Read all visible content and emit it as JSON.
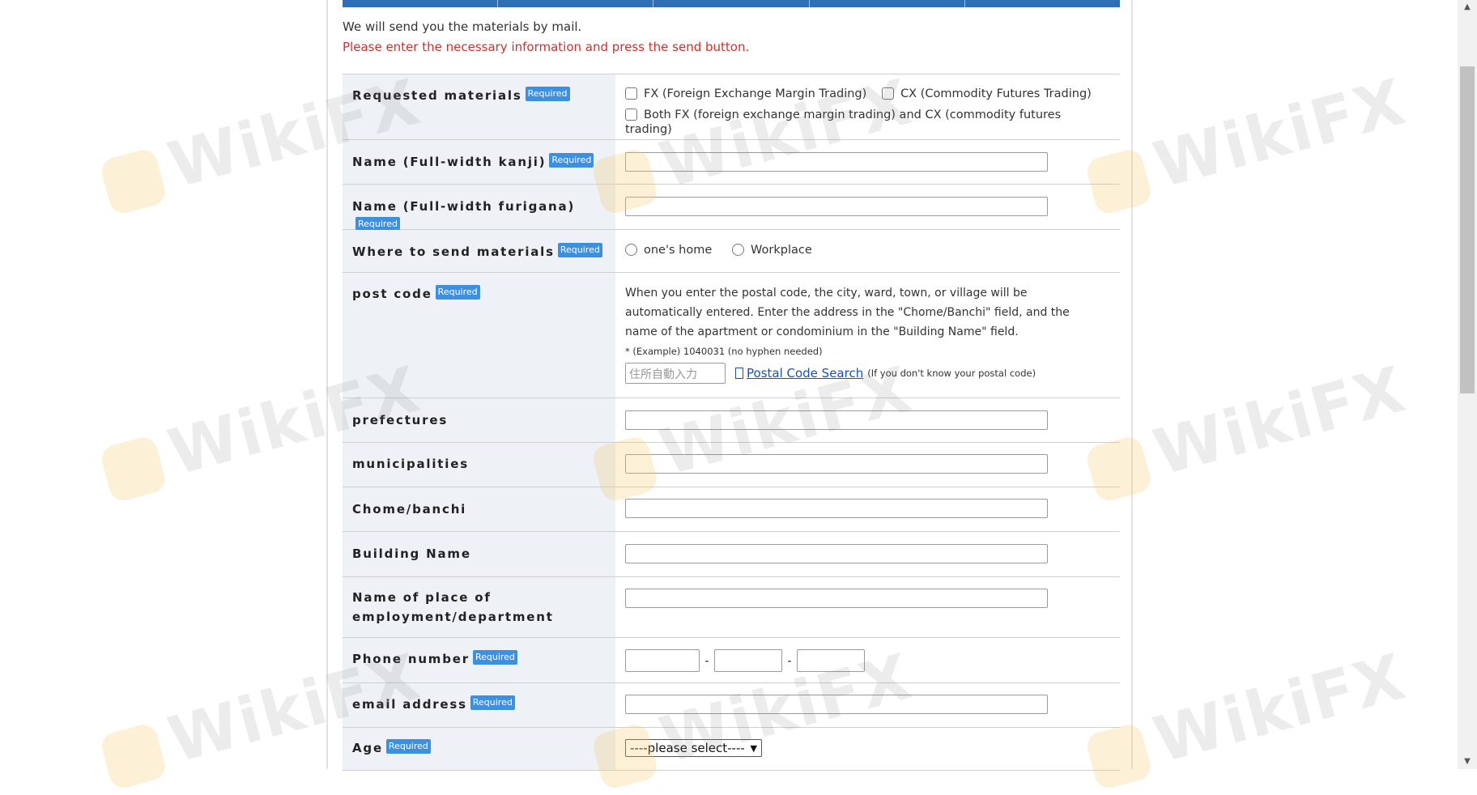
{
  "intro": {
    "line1": "We will send you the materials by mail.",
    "line2": "Please enter the necessary information and press the send button."
  },
  "required_label": "Required",
  "watermark": "WikiFX",
  "form": {
    "requested_materials": {
      "label": "Requested materials",
      "opt_fx": "FX (Foreign Exchange Margin Trading)",
      "opt_cx": "CX (Commodity Futures Trading)",
      "opt_both": "Both FX (foreign exchange margin trading) and CX (commodity futures trading)"
    },
    "name_kanji": {
      "label": "Name (Full-width kanji)"
    },
    "name_furigana": {
      "label": "Name (Full-width furigana)"
    },
    "send_to": {
      "label": "Where to send materials",
      "opt_home": "one's home",
      "opt_work": "Workplace"
    },
    "post_code": {
      "label": "post code",
      "desc": "When you enter the postal code, the city, ward, town, or village will be automatically entered. Enter the address in the \"Chome/Banchi\" field, and the name of the apartment or condominium in the \"Building Name\" field.",
      "example": "* (Example) 1040031 (no hyphen needed)",
      "placeholder": "住所自動入力",
      "search_link": "Postal Code Search",
      "search_note": "(If you don't know your postal code)"
    },
    "prefectures": {
      "label": "prefectures"
    },
    "municipalities": {
      "label": "municipalities"
    },
    "chome": {
      "label": "Chome/banchi"
    },
    "building": {
      "label": "Building Name"
    },
    "employment": {
      "label": "Name of place of employment/department"
    },
    "phone": {
      "label": "Phone number",
      "sep": "-"
    },
    "email": {
      "label": "email address"
    },
    "age": {
      "label": "Age",
      "selected": "----please select----"
    }
  }
}
